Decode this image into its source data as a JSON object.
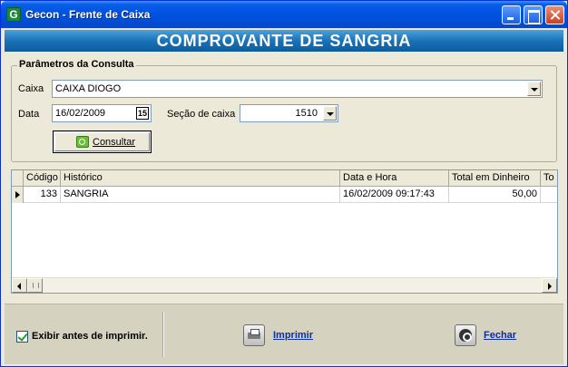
{
  "window": {
    "title": "Gecon - Frente de Caixa",
    "icon": "gecon-app-icon",
    "icon_letter": "G"
  },
  "banner": {
    "title": "COMPROVANTE DE SANGRIA"
  },
  "params": {
    "legend": "Parâmetros da Consulta",
    "caixa_label": "Caixa",
    "caixa_value": "CAIXA DIOGO",
    "data_label": "Data",
    "data_value": "16/02/2009",
    "calendar_label": "15",
    "secao_label": "Seção de caixa",
    "secao_value": "1510",
    "consultar_label": "Consultar"
  },
  "grid": {
    "columns": [
      "Código",
      "Histórico",
      "Data e Hora",
      "Total em Dinheiro",
      "To"
    ],
    "rows": [
      {
        "codigo": "133",
        "historico": "SANGRIA",
        "data_hora": "16/02/2009 09:17:43",
        "total_dinheiro": "50,00",
        "extra": ""
      }
    ]
  },
  "footer": {
    "exibir_label": "Exibir antes de imprimir.",
    "exibir_checked": true,
    "imprimir_label": "Imprimir",
    "fechar_label": "Fechar"
  },
  "colors": {
    "titlebar": "#0054e3",
    "banner": "#1a73b8",
    "link": "#0a2ea6",
    "check": "#21a121"
  }
}
